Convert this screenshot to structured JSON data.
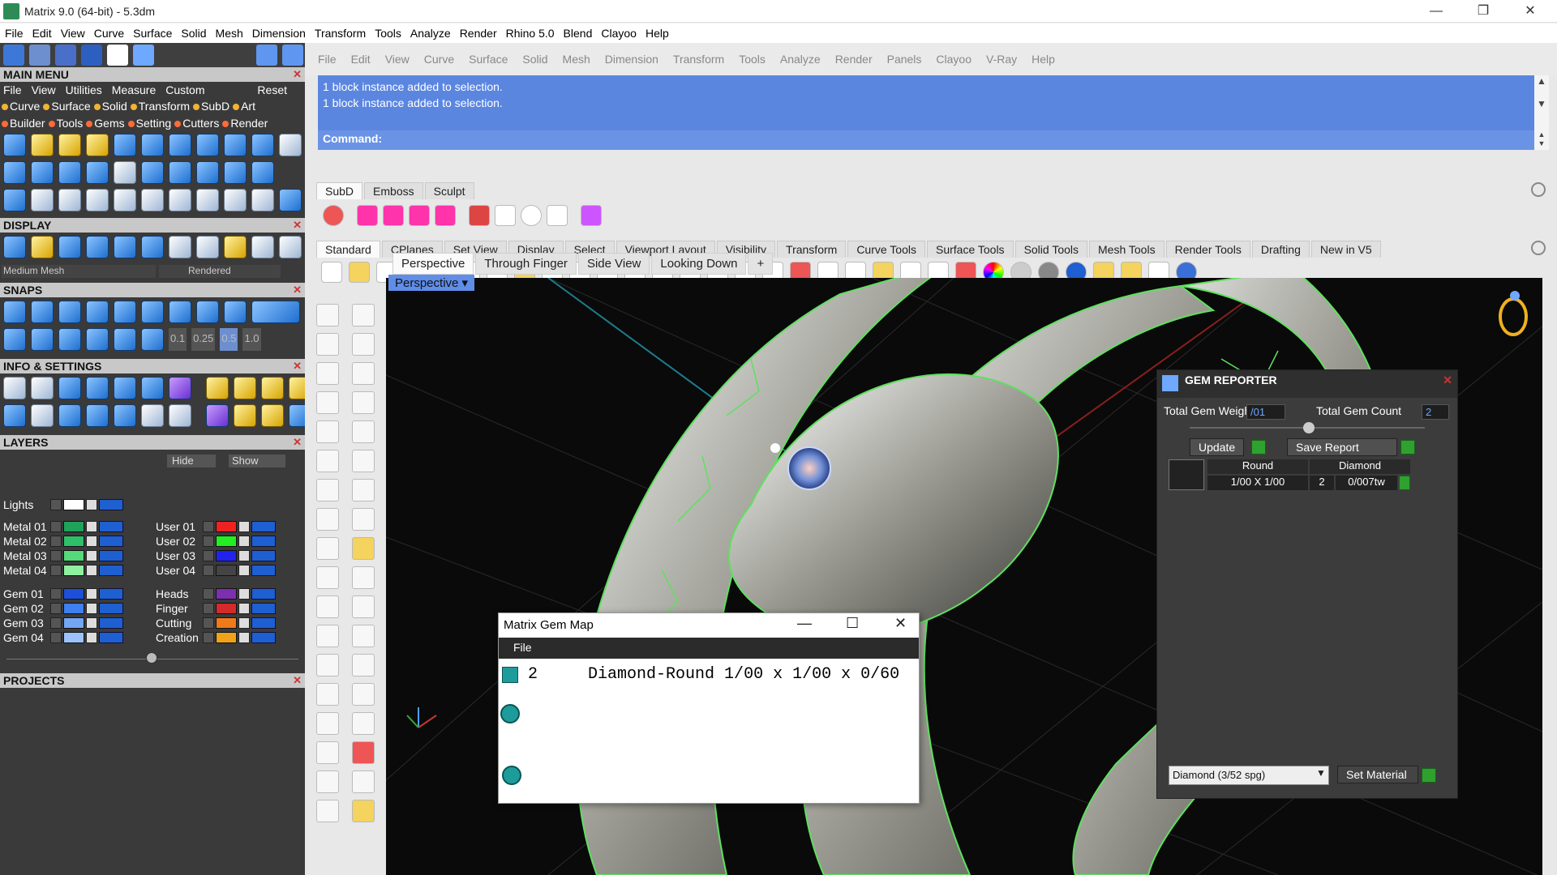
{
  "window": {
    "title": "Matrix 9.0 (64-bit) - 5.3dm",
    "minimize": "—",
    "restore": "❐",
    "close": "✕"
  },
  "menubar": [
    "File",
    "Edit",
    "View",
    "Curve",
    "Surface",
    "Solid",
    "Mesh",
    "Dimension",
    "Transform",
    "Tools",
    "Analyze",
    "Render",
    "Rhino 5.0",
    "Blend",
    "Clayoo",
    "Help"
  ],
  "left": {
    "main_menu_title": "MAIN MENU",
    "main_menu_items": [
      "File",
      "View",
      "Utilities",
      "Measure",
      "Custom"
    ],
    "reset": "Reset",
    "cats_row1": [
      {
        "label": "Curve",
        "color": "#f2b234"
      },
      {
        "label": "Surface",
        "color": "#f2b234"
      },
      {
        "label": "Solid",
        "color": "#f2b234"
      },
      {
        "label": "Transform",
        "color": "#f2b234"
      },
      {
        "label": "SubD",
        "color": "#f2b234"
      },
      {
        "label": "Art",
        "color": "#f2b234"
      }
    ],
    "cats_row2": [
      {
        "label": "Builder",
        "color": "#ff6a3a"
      },
      {
        "label": "Tools",
        "color": "#ff6a3a"
      },
      {
        "label": "Gems",
        "color": "#ff6a3a"
      },
      {
        "label": "Setting",
        "color": "#ff6a3a"
      },
      {
        "label": "Cutters",
        "color": "#ff6a3a"
      },
      {
        "label": "Render",
        "color": "#ff6a3a"
      }
    ],
    "display_title": "DISPLAY",
    "display_mesh": "Medium Mesh",
    "display_mode": "Rendered",
    "snaps_title": "SNAPS",
    "snap_values": [
      "0.1",
      "0.25",
      "0.5",
      "1.0"
    ],
    "info_title": "INFO & SETTINGS",
    "layers_title": "LAYERS",
    "hide_label": "Hide",
    "show_label": "Show",
    "layers_left": [
      {
        "name": "Lights",
        "color": "#ffffff"
      },
      {
        "name": "Metal 01",
        "color": "#1fa35a"
      },
      {
        "name": "Metal 02",
        "color": "#2fbf6a"
      },
      {
        "name": "Metal 03",
        "color": "#55d97a"
      },
      {
        "name": "Metal 04",
        "color": "#8ff0a0"
      },
      {
        "name": "Gem 01",
        "color": "#1d4fd8"
      },
      {
        "name": "Gem 02",
        "color": "#3f7ff0"
      },
      {
        "name": "Gem 03",
        "color": "#73a6f5"
      },
      {
        "name": "Gem 04",
        "color": "#9cc2fa"
      }
    ],
    "layers_right": [
      {
        "name": "User 01",
        "color": "#e22"
      },
      {
        "name": "User 02",
        "color": "#2e2"
      },
      {
        "name": "User 03",
        "color": "#22e"
      },
      {
        "name": "User 04",
        "color": "#444"
      },
      {
        "name": "Heads",
        "color": "#7d2fb0"
      },
      {
        "name": "Finger",
        "color": "#d42a2a"
      },
      {
        "name": "Cutting",
        "color": "#f07a1a"
      },
      {
        "name": "Creation",
        "color": "#f0a21a"
      }
    ],
    "projects_title": "PROJECTS"
  },
  "inner_menu": [
    "File",
    "Edit",
    "View",
    "Curve",
    "Surface",
    "Solid",
    "Mesh",
    "Dimension",
    "Transform",
    "Tools",
    "Analyze",
    "Render",
    "Panels",
    "Clayoo",
    "V-Ray",
    "Help"
  ],
  "command_history": [
    "1 block instance added to selection.",
    "1 block instance added to selection."
  ],
  "command_label": "Command:",
  "subd_tabs": [
    "SubD",
    "Emboss",
    "Sculpt"
  ],
  "std_tabs": [
    "Standard",
    "CPlanes",
    "Set View",
    "Display",
    "Select",
    "Viewport Layout",
    "Visibility",
    "Transform",
    "Curve Tools",
    "Surface Tools",
    "Solid Tools",
    "Mesh Tools",
    "Render Tools",
    "Drafting",
    "New in V5"
  ],
  "viewport_tabs": [
    "Perspective",
    "Through Finger",
    "Side View",
    "Looking Down"
  ],
  "viewport_add": "+",
  "viewport_label": "Perspective",
  "gem_reporter": {
    "title": "GEM REPORTER",
    "total_weight_label": "Total Gem Weight",
    "total_weight_value": "/01",
    "total_count_label": "Total Gem Count",
    "total_count_value": "2",
    "update": "Update",
    "save_report": "Save Report",
    "col1": "Round",
    "col2": "Diamond",
    "row_size": "1/00 X 1/00",
    "row_count": "2",
    "row_weight": "0/007tw",
    "material": "Diamond    (3/52 spg)",
    "set_material": "Set Material"
  },
  "gem_map": {
    "title": "Matrix Gem Map",
    "menu": "File",
    "count": "2",
    "desc": "Diamond-Round 1/00 x 1/00 x 0/60"
  }
}
